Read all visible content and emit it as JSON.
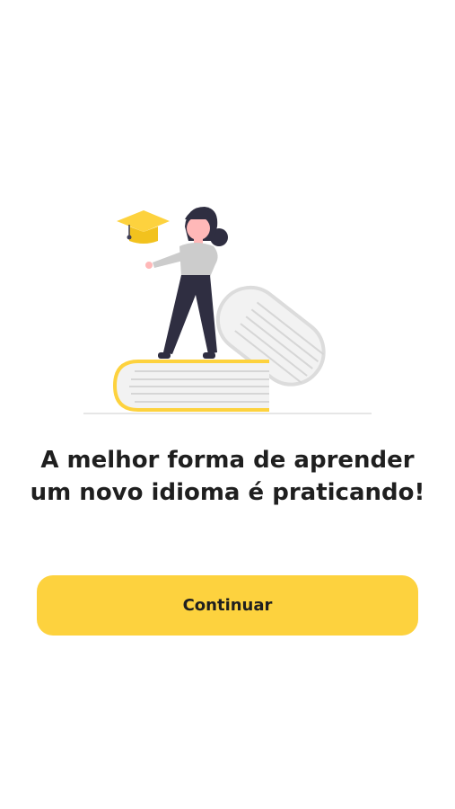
{
  "onboarding": {
    "illustration": "student-on-books-illustration",
    "headline": "A melhor forma de aprender um novo idioma é praticando!",
    "continue_label": "Continuar"
  },
  "colors": {
    "accent": "#fdd23e",
    "text": "#1f1f1f",
    "background": "#ffffff"
  }
}
